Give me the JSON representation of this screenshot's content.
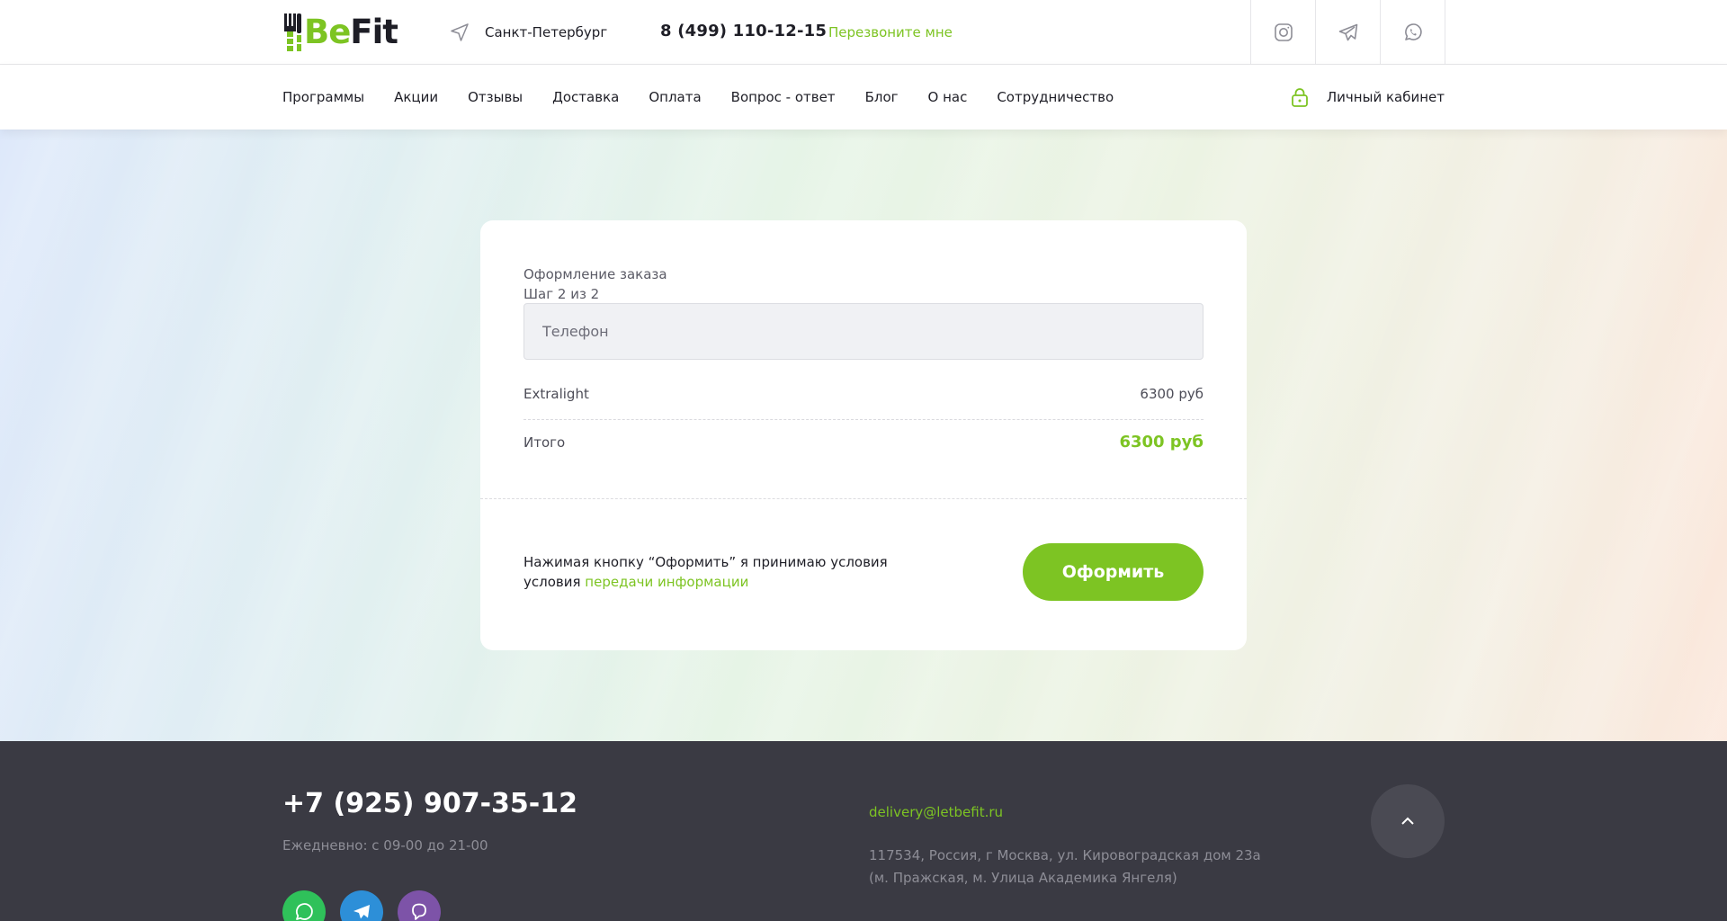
{
  "header": {
    "logo": {
      "part1": "Be",
      "part2": "Fit"
    },
    "city": "Санкт-Петербург",
    "phone": "8 (499) 110-12-15",
    "callback": "Перезвоните мне",
    "socials": [
      "instagram-icon",
      "telegram-icon",
      "whatsapp-icon"
    ]
  },
  "nav": {
    "items": [
      {
        "label": "Программы"
      },
      {
        "label": "Акции"
      },
      {
        "label": "Отзывы"
      },
      {
        "label": "Доставка"
      },
      {
        "label": "Оплата"
      },
      {
        "label": "Вопрос - ответ"
      },
      {
        "label": "Блог"
      },
      {
        "label": "О нас"
      },
      {
        "label": "Сотрудничество"
      }
    ],
    "account": "Личный кабинет"
  },
  "order": {
    "title": "Оформление заказа",
    "step": "Шаг 2 из 2",
    "phone_placeholder": "Телефон",
    "item_name": "Extralight",
    "item_price": "6300 руб",
    "total_label": "Итого",
    "total_value": "6300 руб",
    "consent_text": "Нажимая кнопку “Оформить” я принимаю условия условия",
    "consent_link": "передачи информации",
    "submit": "Оформить"
  },
  "footer": {
    "phone": "+7 (925) 907-35-12",
    "hours": "Ежедневно: с 09-00 до 21-00",
    "email": "delivery@letbefit.ru",
    "address_line1": "117534, Россия, г Москва, ул. Кировоградская дом 23а",
    "address_line2": "(м. Пражская, м. Улица Академика Янгеля)",
    "socials": [
      {
        "icon": "whatsapp-icon",
        "color": "#2fc15a"
      },
      {
        "icon": "telegram-icon",
        "color": "#2d8fd8"
      },
      {
        "icon": "viber-icon",
        "color": "#7d53a8"
      }
    ]
  },
  "colors": {
    "accent": "#7dc423",
    "footer_bg": "#3a3a43",
    "text": "#1e1e26"
  }
}
